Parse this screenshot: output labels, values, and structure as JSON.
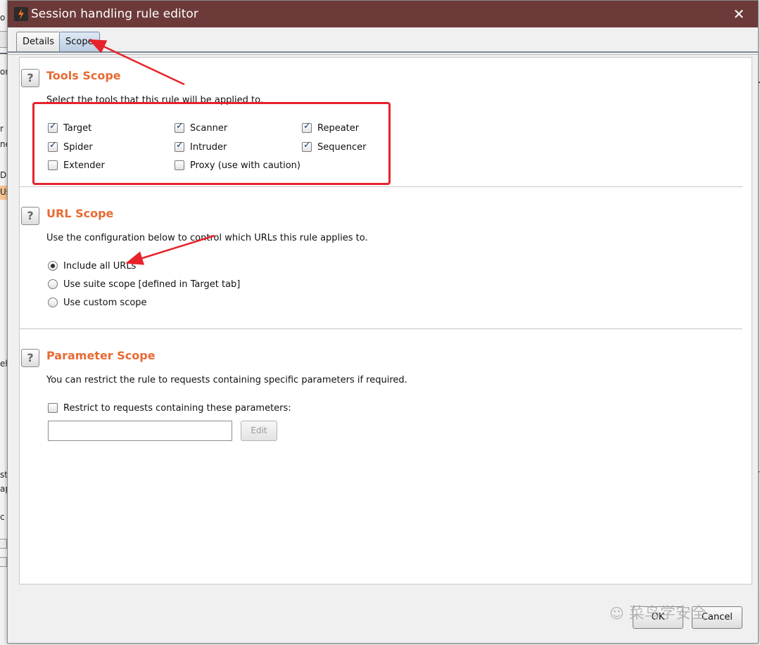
{
  "dialog": {
    "title": "Session handling rule editor",
    "close_glyph": "✕"
  },
  "tabs": [
    {
      "label": "Details",
      "active": false
    },
    {
      "label": "Scope",
      "active": true
    }
  ],
  "tools_scope": {
    "title": "Tools Scope",
    "description": "Select the tools that this rule will be applied to.",
    "tools": [
      {
        "label": "Target",
        "checked": true
      },
      {
        "label": "Scanner",
        "checked": true
      },
      {
        "label": "Repeater",
        "checked": true
      },
      {
        "label": "Spider",
        "checked": true
      },
      {
        "label": "Intruder",
        "checked": true
      },
      {
        "label": "Sequencer",
        "checked": true
      },
      {
        "label": "Extender",
        "checked": false
      },
      {
        "label": "Proxy (use with caution)",
        "checked": false
      }
    ]
  },
  "url_scope": {
    "title": "URL Scope",
    "description": "Use the configuration below to control which URLs this rule applies to.",
    "options": [
      {
        "label": "Include all URLs",
        "selected": true
      },
      {
        "label": "Use suite scope [defined in Target tab]",
        "selected": false
      },
      {
        "label": "Use custom scope",
        "selected": false
      }
    ]
  },
  "parameter_scope": {
    "title": "Parameter Scope",
    "description": "You can restrict the rule to requests containing specific parameters if required.",
    "restrict_label": "Restrict to requests containing these parameters:",
    "restrict_checked": false,
    "input_value": "",
    "edit_label": "Edit"
  },
  "footer": {
    "ok_label": "OK",
    "cancel_label": "Cancel"
  },
  "watermark": "菜鸟学安全",
  "help_glyph": "?",
  "colors": {
    "titlebar": "#6d3a3a",
    "section_title": "#e86a33",
    "annotation": "#e8222b"
  }
}
